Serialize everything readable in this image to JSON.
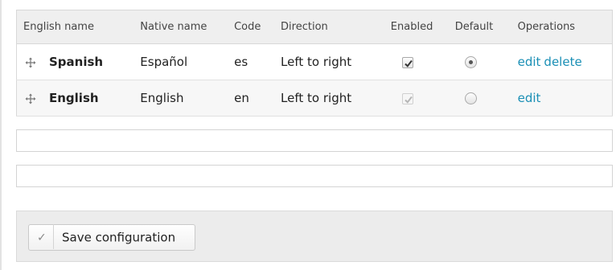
{
  "table": {
    "headers": {
      "english_name": "English name",
      "native_name": "Native name",
      "code": "Code",
      "direction": "Direction",
      "enabled": "Enabled",
      "default": "Default",
      "operations": "Operations"
    },
    "rows": [
      {
        "english_name": "Spanish",
        "native_name": "Español",
        "code": "es",
        "direction": "Left to right",
        "enabled": true,
        "enabled_locked": false,
        "default": true,
        "operations": [
          "edit",
          "delete"
        ]
      },
      {
        "english_name": "English",
        "native_name": "English",
        "code": "en",
        "direction": "Left to right",
        "enabled": true,
        "enabled_locked": true,
        "default": false,
        "operations": [
          "edit"
        ]
      }
    ]
  },
  "actions": {
    "save_label": "Save configuration"
  },
  "colors": {
    "link": "#1a8fb5",
    "header_bg": "#efefef",
    "panel_bg": "#ececec"
  }
}
